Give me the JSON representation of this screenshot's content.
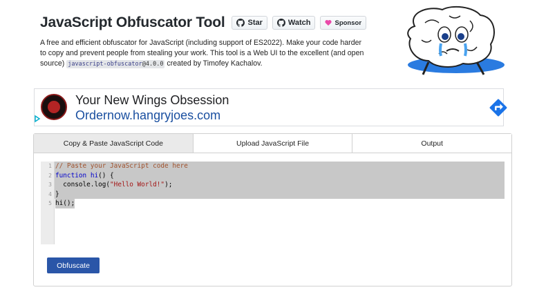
{
  "header": {
    "title": "JavaScript Obfuscator Tool",
    "buttons": {
      "star": "Star",
      "watch": "Watch",
      "sponsor": "Sponsor"
    },
    "description_1": "A free and efficient obfuscator for JavaScript (including support of ES2022). Make your code harder to copy and prevent people from stealing your work. This tool is a Web UI to the excellent (and open source)",
    "package": "javascript-obfuscator",
    "version": "@4.0.0",
    "description_2": "created by Timofey Kachalov."
  },
  "ad": {
    "headline": "Your New Wings Obsession",
    "url": "Ordernow.hangryjoes.com",
    "choice_icon": "adchoices-icon"
  },
  "tabs": [
    {
      "label": "Copy & Paste JavaScript Code",
      "active": true
    },
    {
      "label": "Upload JavaScript File",
      "active": false
    },
    {
      "label": "Output",
      "active": false
    }
  ],
  "editor": {
    "line_numbers": [
      "1",
      "2",
      "3",
      "4",
      "5"
    ],
    "lines": [
      {
        "parts": [
          {
            "cls": "c-comment",
            "text": "// Paste your JavaScript code here"
          }
        ]
      },
      {
        "parts": [
          {
            "cls": "c-kw",
            "text": "function"
          },
          {
            "cls": "",
            "text": " "
          },
          {
            "cls": "c-fn",
            "text": "hi"
          },
          {
            "cls": "",
            "text": "() {"
          }
        ]
      },
      {
        "parts": [
          {
            "cls": "",
            "text": "  console.log("
          },
          {
            "cls": "c-str",
            "text": "\"Hello World!\""
          },
          {
            "cls": "",
            "text": ");"
          }
        ]
      },
      {
        "parts": [
          {
            "cls": "",
            "text": "}"
          }
        ]
      },
      {
        "parts": [
          {
            "cls": "",
            "text": "hi();"
          }
        ]
      }
    ]
  },
  "actions": {
    "obfuscate": "Obfuscate"
  },
  "colors": {
    "accent": "#2a56a8",
    "tab_active": "#eaeaea",
    "ad_url": "#1a4fa0",
    "ad_arrow": "#1a73e8"
  }
}
